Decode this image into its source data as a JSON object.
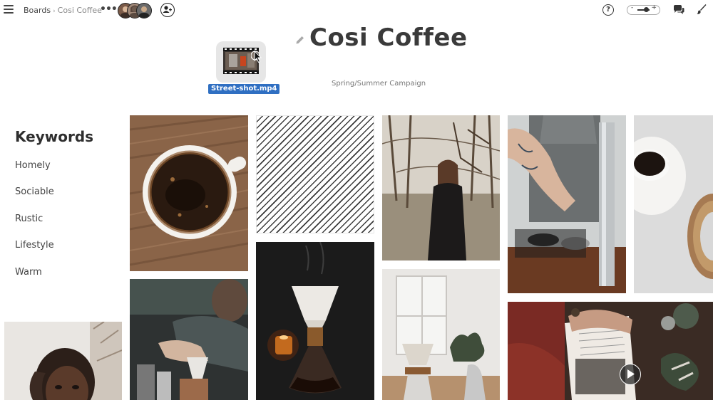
{
  "topbar": {
    "breadcrumb_root": "Boards",
    "breadcrumb_separator": "›",
    "breadcrumb_current": "Cosi Coffee",
    "more_label": "•••",
    "help_label": "?",
    "zoom_minus": "-",
    "zoom_plus": "+"
  },
  "board": {
    "title": "Cosi Coffee",
    "subtitle": "Spring/Summer Campaign"
  },
  "file": {
    "name": "Street-shot.mp4"
  },
  "keywords": {
    "heading": "Keywords",
    "items": [
      "Homely",
      "Sociable",
      "Rustic",
      "Lifestyle",
      "Warm"
    ]
  },
  "icons": {
    "menu": "hamburger-icon",
    "more": "more-icon",
    "add_user": "add-user-icon",
    "help": "help-icon",
    "comments": "comments-icon",
    "brush": "brush-icon",
    "pencil": "pencil-icon",
    "play": "play-icon",
    "cursor": "cursor-icon"
  },
  "colors": {
    "accent": "#2f6fc2",
    "title": "#3a3a3a",
    "text": "#444444"
  }
}
